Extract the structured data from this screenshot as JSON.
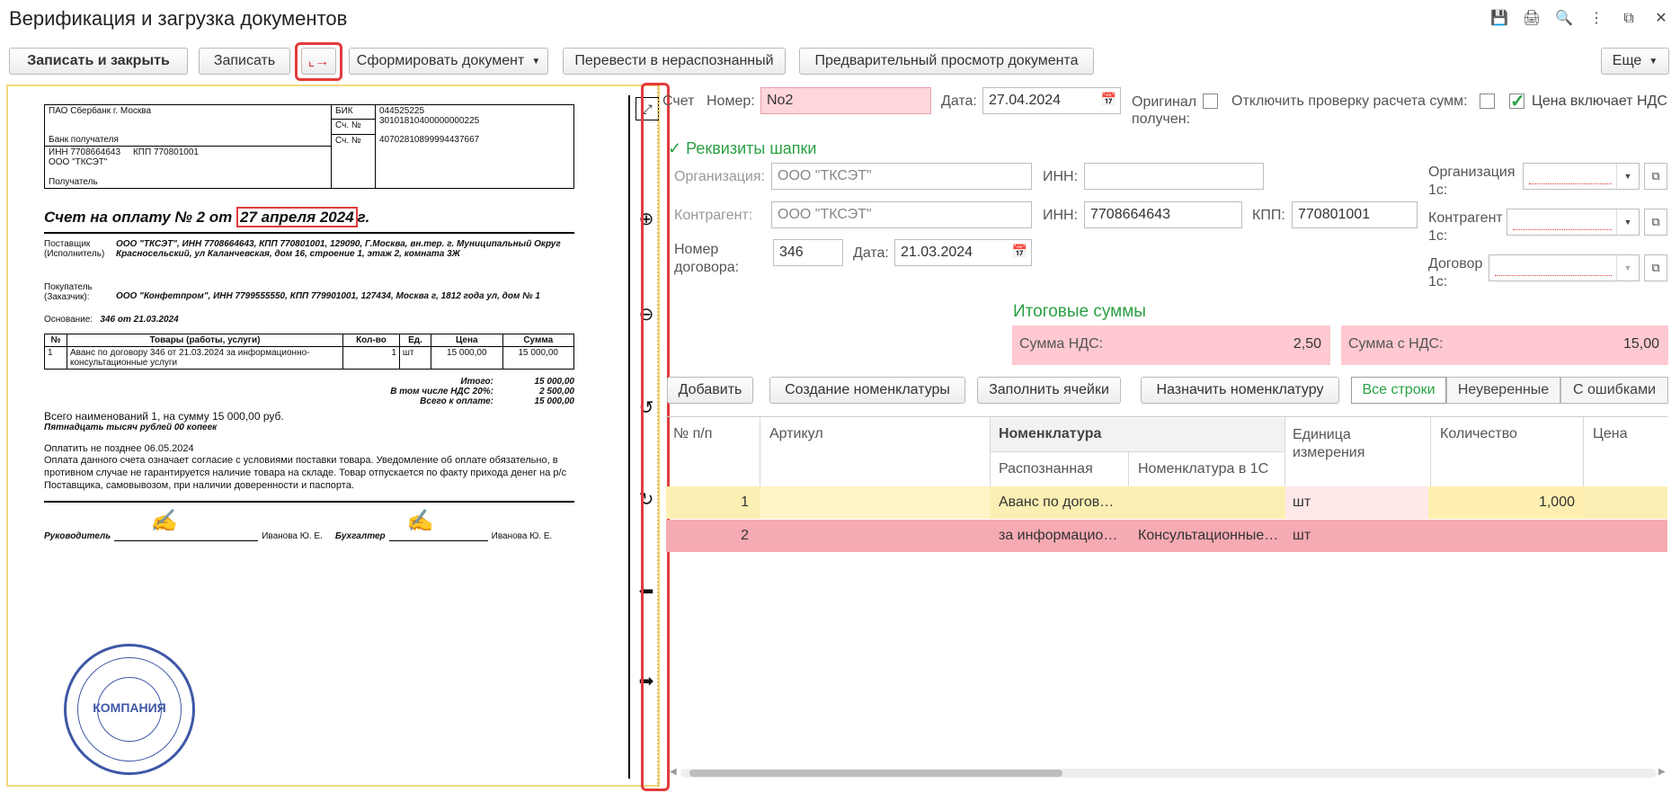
{
  "window": {
    "title": "Верификация и загрузка документов",
    "icons": [
      "save-icon",
      "print-icon",
      "preview-icon",
      "more-vert-icon",
      "restore-icon",
      "close-icon"
    ]
  },
  "toolbar": {
    "save_close": "Записать и закрыть",
    "save": "Записать",
    "form_doc": "Сформировать документ",
    "to_unrecognized": "Перевести в нераспознанный",
    "preview": "Предварительный просмотр документа",
    "more": "Еще"
  },
  "invoice": {
    "bank_name": "ПАО Сбербанк г. Москва",
    "bik_label": "БИК",
    "bik": "044525225",
    "acc_label": "Сч. №",
    "corr_account": "30101810400000000225",
    "bank_recipient_label": "Банк получателя",
    "inn_label": "ИНН",
    "inn": "7708664643",
    "kpp_label": "КПП",
    "kpp": "770801001",
    "account": "40702810899994437667",
    "recipient": "ООО \"ТКСЭТ\"",
    "recipient_label": "Получатель",
    "title_prefix": "Счет на оплату № 2 от",
    "title_date": "27 апреля 2024",
    "title_suffix": "г.",
    "supplier_label": "Поставщик (Исполнитель)",
    "supplier": "ООО \"ТКСЭТ\", ИНН 7708664643, КПП 770801001, 129090, Г.Москва, вн.тер. г. Муниципальный Округ Красносельский, ул Каланчевская, дом 16, строение 1, этаж 2, комната 3Ж",
    "buyer_label": "Покупатель (Заказчик):",
    "buyer": "ООО \"Конфетпром\", ИНН 7799555550, КПП 779901001, 127434, Москва г, 1812 года ул, дом № 1",
    "basis_label": "Основание:",
    "basis": "346 от 21.03.2024",
    "goods_headers": [
      "№",
      "Товары (работы, услуги)",
      "Кол-во",
      "Ед.",
      "Цена",
      "Сумма"
    ],
    "goods_rows": [
      [
        "1",
        "Аванс по договору 346 от 21.03.2024 за информационно-консультационные услуги",
        "1",
        "шт",
        "15 000,00",
        "15 000,00"
      ]
    ],
    "total_label": "Итого:",
    "total": "15 000,00",
    "vat_label": "В том числе НДС 20%:",
    "vat": "2 500,00",
    "pay_label": "Всего к оплате:",
    "pay": "15 000,00",
    "summary": "Всего наименований 1, на сумму 15 000,00 руб.",
    "summary_words": "Пятнадцать тысяч рублей 00 копеек",
    "pay_until": "Оплатить не позднее 06.05.2024",
    "terms": "Оплата данного счета означает согласие с условиями поставки товара. Уведомление об оплате обязательно, в противном случае не гарантируется наличие товара на складе. Товар отпускается по факту прихода денег на р/с Поставщика, самовывозом, при наличии доверенности и паспорта.",
    "head_label": "Руководитель",
    "head_name": "Иванова Ю. Е.",
    "acc_person_label": "Бухгалтер",
    "acc_person_name": "Иванова Ю. Е.",
    "stamp_text": "КОМПАНИЯ"
  },
  "form": {
    "doc_type": "Счет",
    "number_label": "Номер:",
    "number": "No2",
    "date_label": "Дата:",
    "date": "27.04.2024",
    "original_label": "Оригинал получен:",
    "disable_check_label": "Отключить проверку расчета сумм:",
    "price_vat_label": "Цена включает НДС",
    "header_section": "Реквизиты шапки",
    "org_label": "Организация:",
    "org_value": "ООО \"ТКСЭТ\"",
    "inn_label": "ИНН:",
    "org_inn": "",
    "counterparty_label": "Контрагент:",
    "counterparty_value": "ООО \"ТКСЭТ\"",
    "cp_inn": "7708664643",
    "kpp_label": "КПП:",
    "cp_kpp": "770801001",
    "contract_no_label": "Номер договора:",
    "contract_no": "346",
    "contract_date_label": "Дата:",
    "contract_date": "21.03.2024",
    "org1c_label": "Организация 1с:",
    "cp1c_label": "Контрагент 1с:",
    "contract1c_label": "Договор 1с:",
    "totals_section": "Итоговые суммы",
    "vat_sum_label": "Сумма НДС:",
    "vat_sum": "2,50",
    "sum_with_vat_label": "Сумма с НДС:",
    "sum_with_vat": "15,00"
  },
  "grid_toolbar": {
    "add": "Добавить",
    "create_nom": "Создание номенклатуры",
    "fill_cells": "Заполнить ячейки",
    "assign_nom": "Назначить номенклатуру",
    "tab_all": "Все строки",
    "tab_unsure": "Неуверенные",
    "tab_errors": "С ошибками"
  },
  "grid": {
    "headers": {
      "num": "№ п/п",
      "article": "Артикул",
      "nomenclature": "Номенклатура",
      "recognized": "Распознанная",
      "nom_1c": "Номенклатура в 1С",
      "unit": "Единица измерения",
      "qty": "Количество",
      "price": "Цена"
    },
    "rows": [
      {
        "num": "1",
        "recognized": "Аванс по догов…",
        "nom_1c": "",
        "unit": "шт",
        "qty": "1,000"
      },
      {
        "num": "2",
        "recognized": "за информацио…",
        "nom_1c": "Консультационные…",
        "unit": "шт",
        "qty": ""
      }
    ]
  }
}
